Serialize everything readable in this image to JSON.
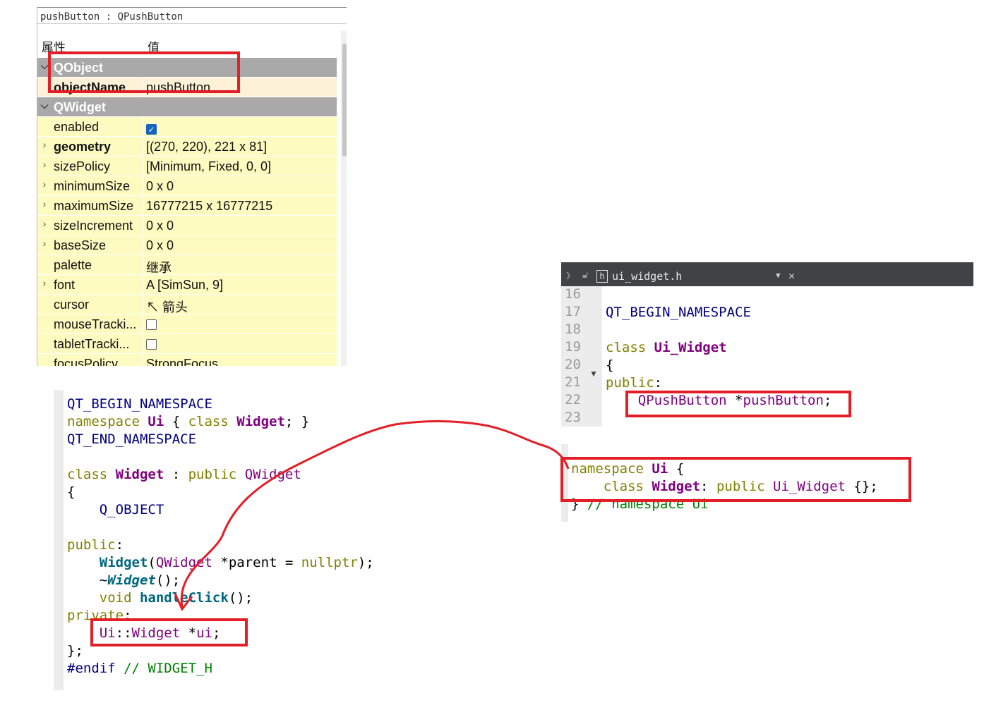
{
  "property_editor": {
    "title": "pushButton : QPushButton",
    "col_property": "属性",
    "col_value": "值",
    "rows": [
      {
        "type": "group",
        "arrow": "⌵",
        "name": "QObject",
        "value": ""
      },
      {
        "type": "prop",
        "arrow": "",
        "name": "objectName",
        "value": "pushButton",
        "bold": true
      },
      {
        "type": "group",
        "arrow": "⌵",
        "name": "QWidget",
        "value": ""
      },
      {
        "type": "prop",
        "arrow": "",
        "name": "enabled",
        "value": "",
        "checkbox": "on"
      },
      {
        "type": "prop",
        "arrow": "›",
        "name": "geometry",
        "value": "[(270, 220), 221 x 81]",
        "bold": true
      },
      {
        "type": "prop",
        "arrow": "›",
        "name": "sizePolicy",
        "value": "[Minimum, Fixed, 0, 0]"
      },
      {
        "type": "prop",
        "arrow": "›",
        "name": "minimumSize",
        "value": "0 x 0"
      },
      {
        "type": "prop",
        "arrow": "›",
        "name": "maximumSize",
        "value": "16777215 x 16777215"
      },
      {
        "type": "prop",
        "arrow": "›",
        "name": "sizeIncrement",
        "value": "0 x 0"
      },
      {
        "type": "prop",
        "arrow": "›",
        "name": "baseSize",
        "value": "0 x 0"
      },
      {
        "type": "prop",
        "arrow": "",
        "name": "palette",
        "value": "继承"
      },
      {
        "type": "prop",
        "arrow": "›",
        "name": "font",
        "value": "A  [SimSun, 9]"
      },
      {
        "type": "prop",
        "arrow": "",
        "name": "cursor",
        "value": "↖ 箭头"
      },
      {
        "type": "prop",
        "arrow": "",
        "name": "mouseTracki...",
        "value": "",
        "checkbox": "off"
      },
      {
        "type": "prop",
        "arrow": "",
        "name": "tabletTracki...",
        "value": "",
        "checkbox": "off"
      },
      {
        "type": "prop",
        "arrow": "",
        "name": "focusPolicy",
        "value": "StrongFocus"
      }
    ]
  },
  "header_file": {
    "tab_filename": "ui_widget.h",
    "line_numbers": [
      "16",
      "17",
      "18",
      "19",
      "20",
      "21",
      "22",
      "23"
    ],
    "lines": [
      [],
      [
        {
          "c": "mac",
          "t": "QT_BEGIN_NAMESPACE"
        }
      ],
      [],
      [
        {
          "c": "kw",
          "t": "class "
        },
        {
          "c": "tyb",
          "t": "Ui_Widget"
        }
      ],
      [
        {
          "c": "pl",
          "t": "{"
        }
      ],
      [
        {
          "c": "kw",
          "t": "public"
        },
        {
          "c": "pl",
          "t": ":"
        }
      ],
      [
        {
          "c": "pl",
          "t": "    "
        },
        {
          "c": "ty",
          "t": "QPushButton"
        },
        {
          "c": "pl",
          "t": " *"
        },
        {
          "c": "ty",
          "t": "pushButton"
        },
        {
          "c": "pl",
          "t": ";"
        }
      ],
      []
    ],
    "lines2": [
      [
        {
          "c": "kw",
          "t": "namespace "
        },
        {
          "c": "tyb",
          "t": "Ui"
        },
        {
          "c": "pl",
          "t": " {"
        }
      ],
      [
        {
          "c": "pl",
          "t": "    "
        },
        {
          "c": "kw",
          "t": "class "
        },
        {
          "c": "tyb",
          "t": "Widget"
        },
        {
          "c": "pl",
          "t": ": "
        },
        {
          "c": "kw",
          "t": "public "
        },
        {
          "c": "ty",
          "t": "Ui_Widget"
        },
        {
          "c": "pl",
          "t": " {};"
        }
      ],
      [
        {
          "c": "pl",
          "t": "} "
        },
        {
          "c": "cm",
          "t": "// namespace Ui"
        }
      ]
    ]
  },
  "widget_header": {
    "lines": [
      [
        {
          "c": "mac",
          "t": "QT_BEGIN_NAMESPACE"
        }
      ],
      [
        {
          "c": "kw",
          "t": "namespace "
        },
        {
          "c": "tyb",
          "t": "Ui"
        },
        {
          "c": "pl",
          "t": " { "
        },
        {
          "c": "kw",
          "t": "class "
        },
        {
          "c": "tyb",
          "t": "Widget"
        },
        {
          "c": "pl",
          "t": "; }"
        }
      ],
      [
        {
          "c": "mac",
          "t": "QT_END_NAMESPACE"
        }
      ],
      [],
      [
        {
          "c": "kw",
          "t": "class "
        },
        {
          "c": "tyb",
          "t": "Widget"
        },
        {
          "c": "pl",
          "t": " : "
        },
        {
          "c": "kw",
          "t": "public "
        },
        {
          "c": "ty",
          "t": "QWidget"
        }
      ],
      [
        {
          "c": "pl",
          "t": "{"
        }
      ],
      [
        {
          "c": "pl",
          "t": "    "
        },
        {
          "c": "mac",
          "t": "Q_OBJECT"
        }
      ],
      [],
      [
        {
          "c": "kw",
          "t": "public"
        },
        {
          "c": "pl",
          "t": ":"
        }
      ],
      [
        {
          "c": "pl",
          "t": "    "
        },
        {
          "c": "fn",
          "t": "Widget"
        },
        {
          "c": "pl",
          "t": "("
        },
        {
          "c": "ty",
          "t": "QWidget"
        },
        {
          "c": "pl",
          "t": " *parent = "
        },
        {
          "c": "kw",
          "t": "nullptr"
        },
        {
          "c": "pl",
          "t": ");"
        }
      ],
      [
        {
          "c": "pl",
          "t": "    ~"
        },
        {
          "c": "fni",
          "t": "Widget"
        },
        {
          "c": "pl",
          "t": "();"
        }
      ],
      [
        {
          "c": "pl",
          "t": "    "
        },
        {
          "c": "kw",
          "t": "void "
        },
        {
          "c": "fn",
          "t": "handleClick"
        },
        {
          "c": "pl",
          "t": "();"
        }
      ],
      [
        {
          "c": "kw",
          "t": "private"
        },
        {
          "c": "pl",
          "t": ":"
        }
      ],
      [
        {
          "c": "pl",
          "t": "    "
        },
        {
          "c": "ty",
          "t": "Ui"
        },
        {
          "c": "pl",
          "t": "::"
        },
        {
          "c": "ty",
          "t": "Widget"
        },
        {
          "c": "pl",
          "t": " *"
        },
        {
          "c": "ty",
          "t": "ui"
        },
        {
          "c": "pl",
          "t": ";"
        }
      ],
      [
        {
          "c": "pl",
          "t": "};"
        }
      ],
      [
        {
          "c": "mac",
          "t": "#endif "
        },
        {
          "c": "cm",
          "t": "// WIDGET_H"
        }
      ]
    ]
  },
  "annotation_color": "#e41e26"
}
